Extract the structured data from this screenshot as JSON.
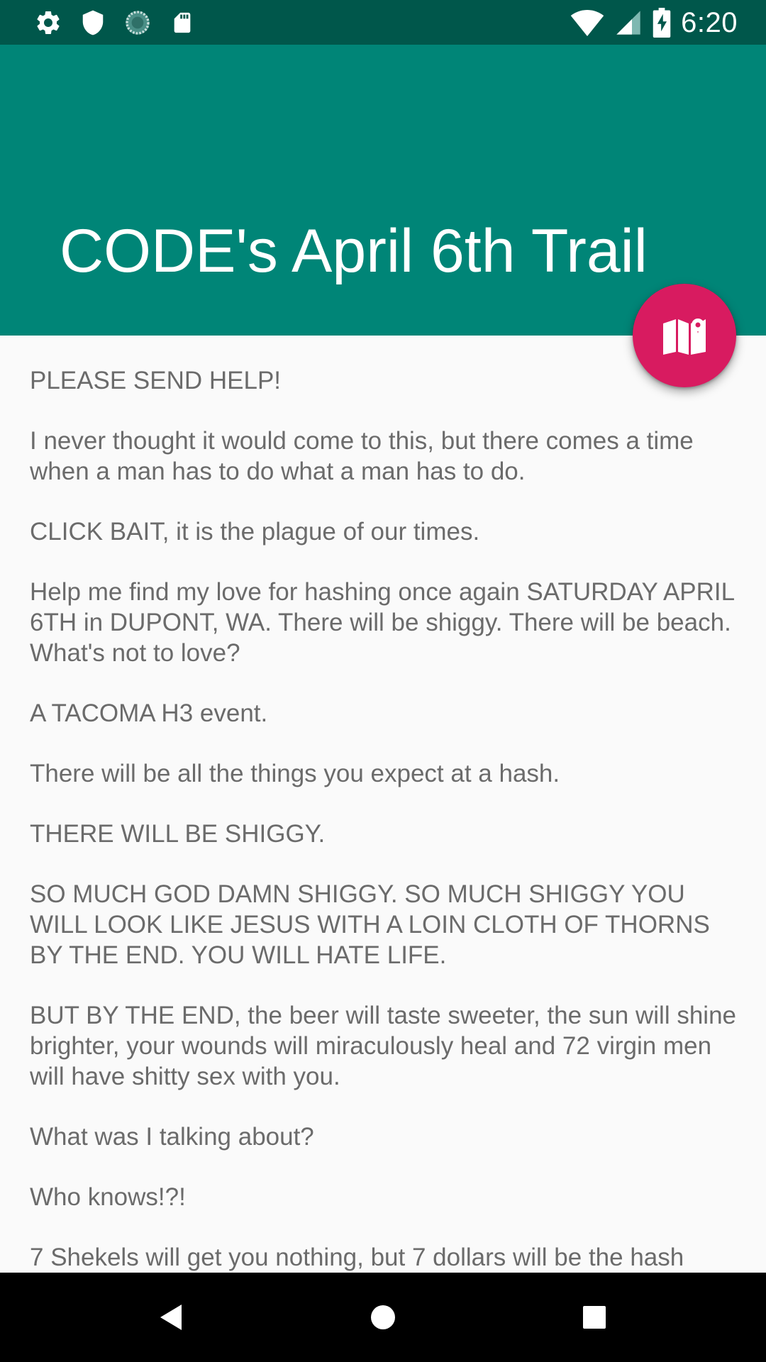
{
  "status_bar": {
    "time": "6:20",
    "left_icons": [
      "settings-icon",
      "shield-icon",
      "sync-icon",
      "sd-card-icon"
    ],
    "right_icons": [
      "wifi-icon",
      "cell-signal-icon",
      "battery-charging-icon"
    ]
  },
  "app_bar": {
    "title": "CODE's April 6th Trail",
    "color": "#008577"
  },
  "fab": {
    "icon": "map-icon",
    "color": "#d81b60"
  },
  "content": {
    "paragraphs": [
      "PLEASE SEND HELP!",
      "I never thought it would come to this, but there comes a time when a man has to do what a man has to do.",
      "CLICK BAIT, it is the plague of our times.",
      "Help me find my love for hashing once again SATURDAY APRIL 6TH in DUPONT, WA. There will be shiggy. There will be beach. What's not to love?",
      "A TACOMA H3 event.",
      "There will be all the things you expect at a hash.",
      "THERE WILL BE SHIGGY.",
      "SO MUCH GOD DAMN SHIGGY. SO MUCH SHIGGY YOU WILL LOOK LIKE JESUS WITH A LOIN CLOTH OF THORNS BY THE END. YOU WILL HATE LIFE.",
      "BUT BY THE END, the beer will taste sweeter, the sun will shine brighter, your wounds will miraculously heal and 72 virgin men will have shitty sex with you.",
      "What was I talking about?",
      "Who knows!?!",
      "7 Shekels will get you nothing, but 7 dollars will be the hash"
    ]
  },
  "nav_bar": {
    "buttons": [
      "back-icon",
      "home-icon",
      "recents-icon"
    ]
  }
}
